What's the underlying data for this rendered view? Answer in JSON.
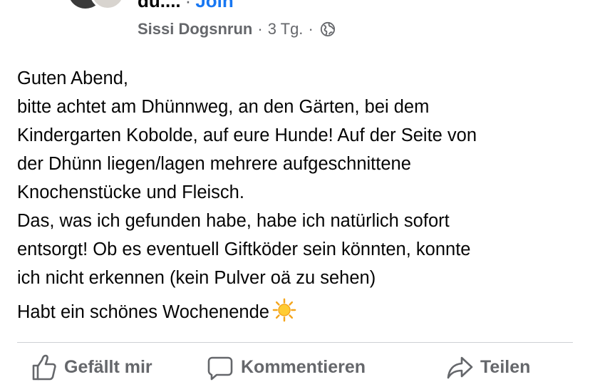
{
  "header": {
    "group_name_truncated": "du....",
    "separator": "·",
    "join_label": "Join"
  },
  "meta": {
    "author": "Sissi Dogsnrun",
    "separator1": "·",
    "time": "3 Tg.",
    "separator2": "·",
    "visibility_icon": "globe-icon"
  },
  "post": {
    "lines": [
      "Guten Abend,",
      "bitte achtet am Dhünnweg, an den Gärten, bei dem",
      "Kindergarten Kobolde, auf eure Hunde! Auf der Seite von",
      "der Dhünn liegen/lagen mehrere aufgeschnittene",
      "Knochenstücke und Fleisch.",
      "Das, was ich gefunden habe, habe ich natürlich sofort",
      "entsorgt! Ob es eventuell Giftköder sein könnten, konnte",
      "ich nicht erkennen (kein Pulver oä zu sehen)"
    ],
    "closing": "Habt ein schönes Wochenende",
    "closing_emoji": "sun-emoji"
  },
  "actions": {
    "like_label": "Gefällt mir",
    "comment_label": "Kommentieren",
    "share_label": "Teilen"
  },
  "colors": {
    "text": "#050505",
    "secondary": "#65676b",
    "link": "#1877f2",
    "divider": "#ced0d4"
  }
}
